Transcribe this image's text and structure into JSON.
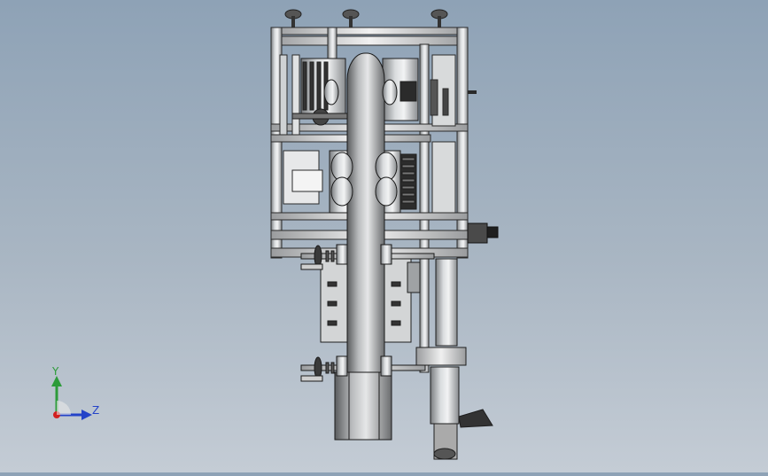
{
  "viewport": {
    "background_top": "#8ea2b6",
    "background_bottom": "#c4ccd5",
    "model": "machine-assembly-side-view"
  },
  "triad": {
    "y_label": "Y",
    "z_label": "Z",
    "y_color": "#2d9b3a",
    "z_color": "#2443c8",
    "x_color": "#d22020",
    "icon": "axis-triad-icon"
  }
}
